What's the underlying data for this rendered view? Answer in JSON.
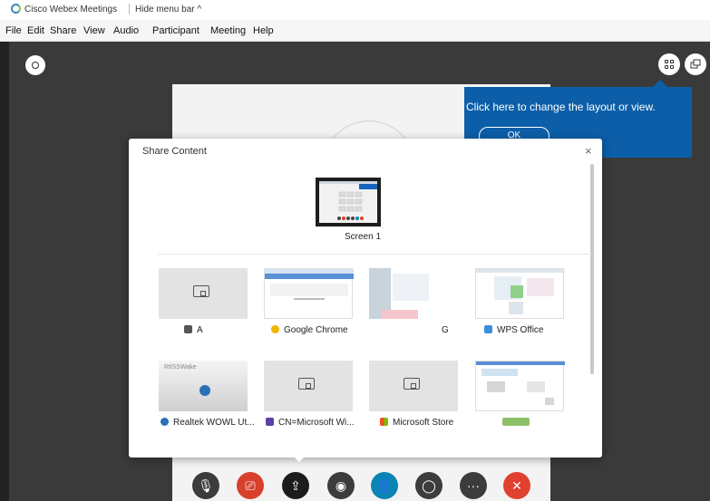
{
  "window": {
    "title": "Cisco Webex Meetings",
    "hide_menu": "Hide menu bar ^"
  },
  "menu": {
    "items": [
      "File",
      "Edit",
      "Share",
      "View",
      "Audio",
      "Participant",
      "Meeting",
      "Help"
    ]
  },
  "tooltip": {
    "text": "Click here to change the layout or view.",
    "ok": "OK"
  },
  "dialog": {
    "title": "Share Content",
    "close": "×",
    "screen": {
      "label": "Screen 1"
    },
    "apps": [
      {
        "label": "A",
        "icon": "window-app-icon"
      },
      {
        "label": "Google Chrome",
        "icon": "chrome-icon"
      },
      {
        "label": "G",
        "icon": "app-icon"
      },
      {
        "label": "WPS Office",
        "icon": "wps-office-icon"
      },
      {
        "label": "Realtek WOWL Ut...",
        "icon": "realtek-icon",
        "thumb_text": "RtlSSWake"
      },
      {
        "label": "CN=Microsoft Wi...",
        "icon": "microsoft-icon"
      },
      {
        "label": "Microsoft Store",
        "icon": "store-icon"
      },
      {
        "label": "",
        "icon": "app-icon"
      }
    ]
  },
  "toolbar": {
    "buttons": [
      {
        "name": "mute-button",
        "glyph": "🎙",
        "color": "#3c3c3c"
      },
      {
        "name": "video-button",
        "glyph": "⎚",
        "color": "#d9402b"
      },
      {
        "name": "share-button",
        "glyph": "⇪",
        "color": "#1c1c1c"
      },
      {
        "name": "record-button",
        "glyph": "◉",
        "color": "#3c3c3c"
      },
      {
        "name": "participants-button",
        "glyph": "👤",
        "color": "#0b84b5"
      },
      {
        "name": "chat-button",
        "glyph": "◯",
        "color": "#3c3c3c"
      },
      {
        "name": "more-button",
        "glyph": "···",
        "color": "#3c3c3c"
      },
      {
        "name": "leave-button",
        "glyph": "✕",
        "color": "#e0402e"
      }
    ]
  }
}
